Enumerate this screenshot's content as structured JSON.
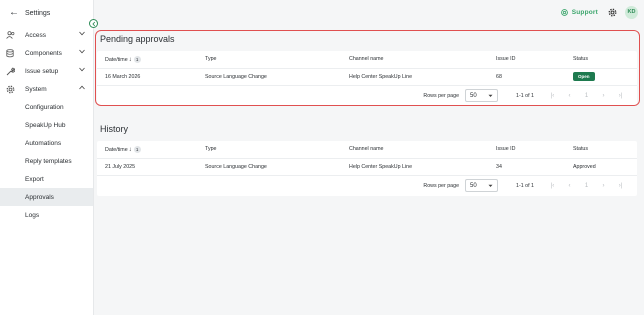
{
  "sidebar": {
    "back_label": "Settings",
    "items": [
      {
        "label": "Access",
        "icon": "users-icon"
      },
      {
        "label": "Components",
        "icon": "database-icon"
      },
      {
        "label": "Issue setup",
        "icon": "wrench-icon"
      },
      {
        "label": "System",
        "icon": "gear-icon"
      }
    ],
    "sub_items": [
      {
        "label": "Configuration"
      },
      {
        "label": "SpeakUp Hub"
      },
      {
        "label": "Automations"
      },
      {
        "label": "Reply templates"
      },
      {
        "label": "Export"
      },
      {
        "label": "Approvals",
        "active": true
      },
      {
        "label": "Logs"
      }
    ]
  },
  "topbar": {
    "support_label": "Support",
    "avatar_initials": "KD"
  },
  "colors": {
    "accent": "#3aa56b",
    "status_open": "#1e7a4f",
    "highlight": "#e05050"
  },
  "pending": {
    "title": "Pending approvals",
    "headers": {
      "date": "Date/time",
      "sort_index": "1",
      "type": "Type",
      "channel": "Channel name",
      "issue": "Issue ID",
      "status": "Status"
    },
    "rows": [
      {
        "date": "16 March 2026",
        "type": "Source Language Change",
        "channel": "Help Center SpeakUp Line",
        "issue": "68",
        "status": "Open"
      }
    ],
    "pager": {
      "rows_per_page_label": "Rows per page",
      "rows_per_page": "50",
      "range": "1-1 of 1",
      "page": "1"
    }
  },
  "history": {
    "title": "History",
    "headers": {
      "date": "Date/time",
      "sort_index": "1",
      "type": "Type",
      "channel": "Channel name",
      "issue": "Issue ID",
      "status": "Status"
    },
    "rows": [
      {
        "date": "21 July 2025",
        "type": "Source Language Change",
        "channel": "Help Center SpeakUp Line",
        "issue": "34",
        "status": "Approved"
      }
    ],
    "pager": {
      "rows_per_page_label": "Rows per page",
      "rows_per_page": "50",
      "range": "1-1 of 1",
      "page": "1"
    }
  }
}
